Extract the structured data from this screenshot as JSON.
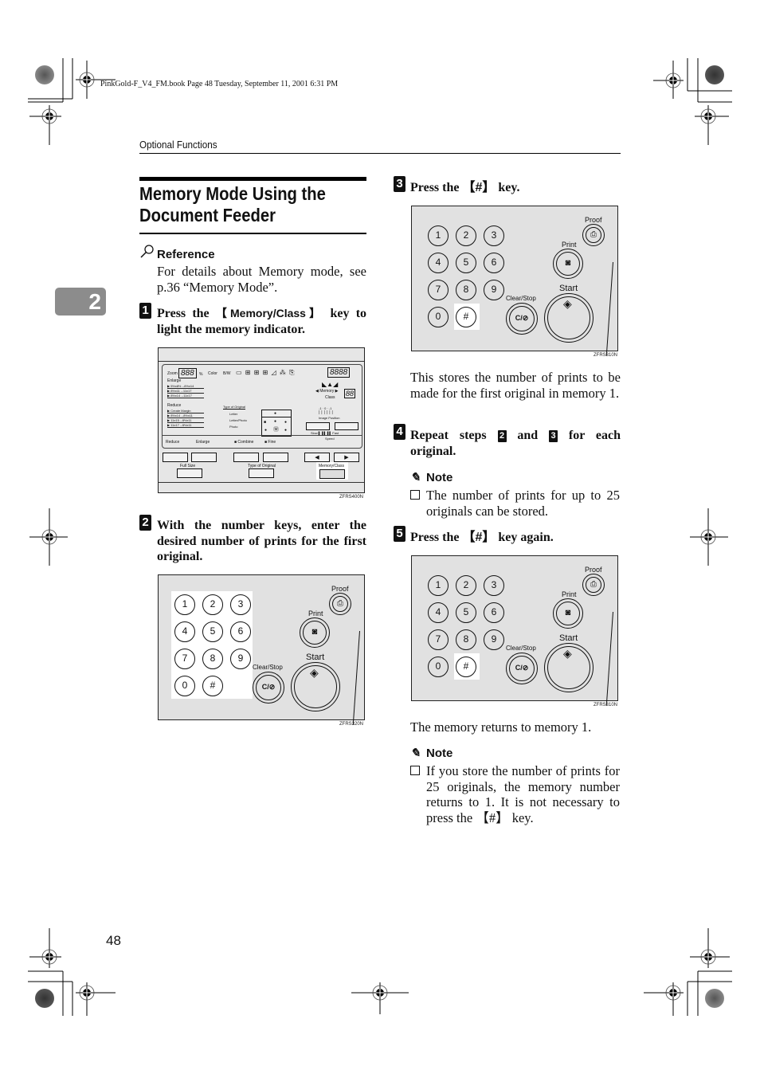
{
  "print_header": {
    "book_line": "PinkGold-F_V4_FM.book  Page 48  Tuesday, September 11, 2001  6:31 PM",
    "running_head": "Optional Functions",
    "chapter_tab": "2",
    "page_number": "48"
  },
  "section": {
    "title_line1": "Memory Mode Using the",
    "title_line2": "Document Feeder"
  },
  "reference": {
    "icon": "magnifier-icon",
    "heading": "Reference",
    "text": "For details about Memory mode, see p.36 “Memory Mode”."
  },
  "steps": [
    {
      "num": "1",
      "text_before": "Press the ",
      "key": "【Memory/Class】",
      "text_after": " key to light the memory indicator."
    },
    {
      "num": "2",
      "text": "With the number keys, enter the desired number of prints for the first original."
    },
    {
      "num": "3",
      "text_before": "Press the ",
      "key": "【#】",
      "text_after": " key.",
      "after_text": "This stores the number of prints to be made for the first original in memory 1."
    },
    {
      "num": "4",
      "text_before": "Repeat steps ",
      "ref1": "2",
      "mid": " and ",
      "ref2": "3",
      "text_after": " for each original.",
      "note": {
        "icon": "pencil-icon",
        "heading": "Note",
        "items": [
          "The number of prints for up to 25 originals can be stored."
        ]
      }
    },
    {
      "num": "5",
      "text_before": "Press the ",
      "key": "【#】",
      "text_after": " key again.",
      "after_text": "The memory returns to memory 1.",
      "note": {
        "icon": "pencil-icon",
        "heading": "Note",
        "items": [
          "If you store the number of prints for 25 originals, the memory number returns to 1. It is not necessary to press the 【#】 key."
        ]
      }
    }
  ],
  "figures": {
    "control_panel": {
      "code": "ZFRS400N",
      "zoom_label": "Zoom",
      "zoom_display": "888",
      "percent": "%",
      "color_label": "Color",
      "bw_label": "B/W",
      "counter_display": "8888",
      "memory_label": "Memory",
      "class_label": "Class",
      "memory_display": "88",
      "enlarge_label": "Enlarge",
      "enlarge_items": [
        "5½x8½→8½x14",
        "8½x11→11x17",
        "8½x14→11x17"
      ],
      "reduce_label": "Reduce",
      "reduce_items": [
        "Create Margin",
        "8½x14→8½x11",
        "11x15→8½x11",
        "11x17→8½x11"
      ],
      "type_of_original_label": "Type of Original",
      "type_items": [
        "Letter",
        "Letter/Photo",
        "Photo"
      ],
      "image_position_scale": "-1 · 0 · -1",
      "image_position_label": "Image Position",
      "speed_slow": "Slow",
      "speed_fast": "Fast",
      "speed_label": "Speed",
      "bottom_labels": [
        "Reduce",
        "Enlarge",
        "■ Combine",
        "■ Fine"
      ],
      "full_size_label": "Full Size",
      "type_of_original_btn_label": "Type of Original",
      "memory_class_label": "Memory/Class"
    },
    "keypad_a": {
      "code": "ZFRS320N",
      "keys": [
        "1",
        "2",
        "3",
        "4",
        "5",
        "6",
        "7",
        "8",
        "9",
        "0",
        "#"
      ],
      "proof_label": "Proof",
      "print_label": "Print",
      "clear_stop_label": "Clear/Stop",
      "clear_stop_key": "C/⊘",
      "start_label": "Start"
    },
    "keypad_b": {
      "code": "ZFRS310N",
      "keys": [
        "1",
        "2",
        "3",
        "4",
        "5",
        "6",
        "7",
        "8",
        "9",
        "0",
        "#"
      ],
      "proof_label": "Proof",
      "print_label": "Print",
      "clear_stop_label": "Clear/Stop",
      "clear_stop_key": "C/⊘",
      "start_label": "Start"
    }
  }
}
